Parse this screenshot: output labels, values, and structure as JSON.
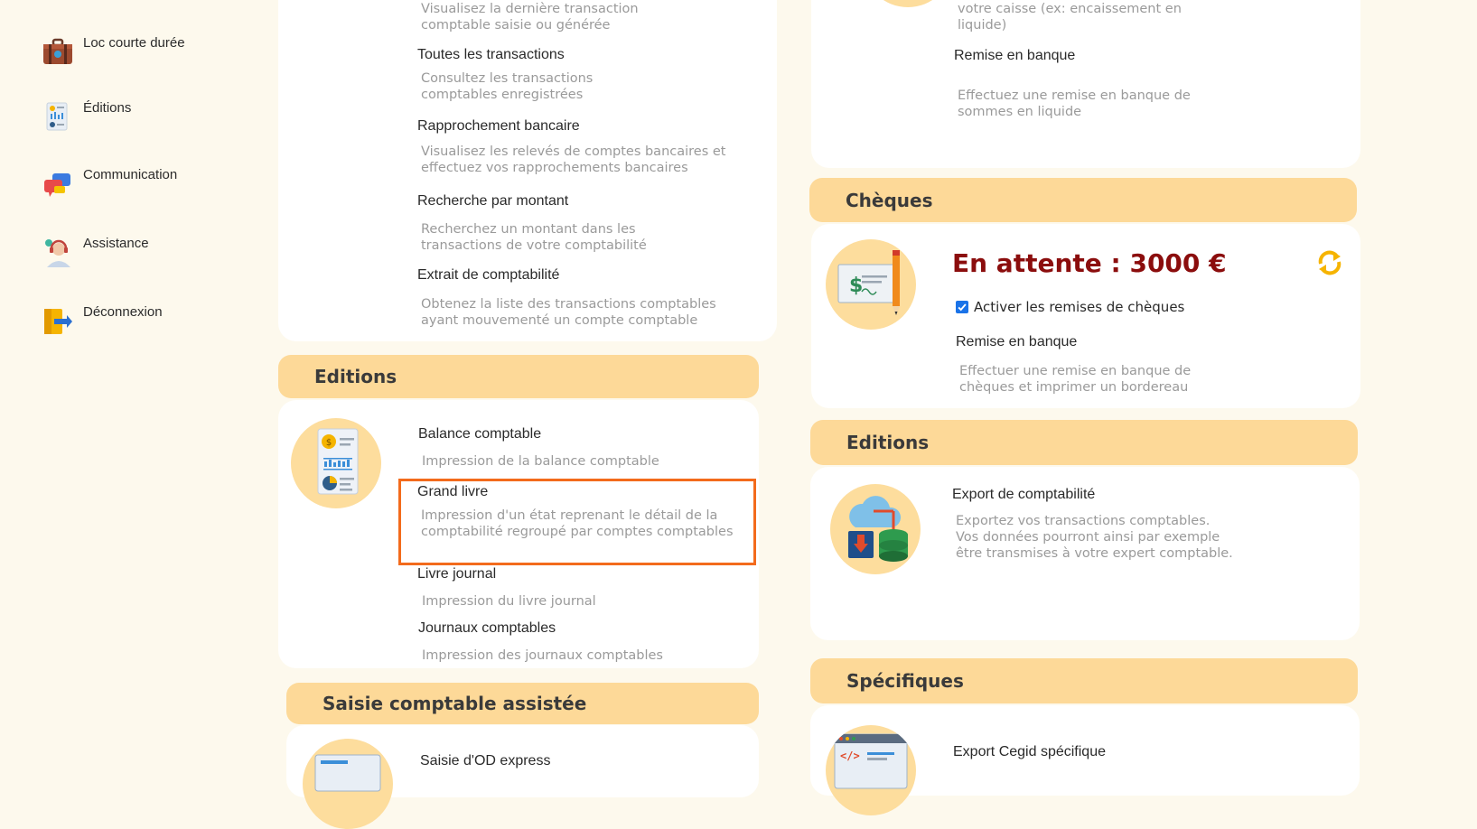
{
  "sidebar": {
    "items": [
      {
        "label": "Loc courte durée",
        "icon": "briefcase-icon"
      },
      {
        "label": "Éditions",
        "icon": "report-icon"
      },
      {
        "label": "Communication",
        "icon": "chat-icon"
      },
      {
        "label": "Assistance",
        "icon": "support-agent-icon"
      },
      {
        "label": "Déconnexion",
        "icon": "logout-icon"
      }
    ]
  },
  "left_top": {
    "frag_desc": "Visualisez la dernière transaction comptable saisie ou générée",
    "items": [
      {
        "title": "Toutes les transactions",
        "desc": "Consultez les transactions comptables enregistrées"
      },
      {
        "title": "Rapprochement bancaire",
        "desc": "Visualisez les relevés de comptes bancaires et effectuez vos rapprochements bancaires"
      },
      {
        "title": "Recherche par montant",
        "desc": "Recherchez un montant dans les transactions de votre comptabilité"
      },
      {
        "title": "Extrait de comptabilité",
        "desc": "Obtenez la liste des transactions comptables ayant mouvementé un compte comptable"
      }
    ]
  },
  "editions_left": {
    "header": "Editions",
    "items": [
      {
        "title": "Balance comptable",
        "desc": "Impression de la balance comptable"
      },
      {
        "title": "Grand livre",
        "desc": "Impression d'un état reprenant le détail de la comptabilité regroupé par comptes comptables"
      },
      {
        "title": "Livre journal",
        "desc": "Impression du livre journal"
      },
      {
        "title": "Journaux comptables",
        "desc": "Impression des journaux comptables"
      }
    ]
  },
  "saisie": {
    "header": "Saisie comptable assistée",
    "item_title": "Saisie d'OD express"
  },
  "caisse": {
    "frag_desc": "votre caisse (ex: encaissement en liquide)",
    "item_title": "Remise en banque",
    "item_desc": "Effectuez une remise en banque de sommes en liquide"
  },
  "cheques": {
    "header": "Chèques",
    "pending": "En attente : 3000 €",
    "checkbox_label": "Activer les remises de chèques",
    "checkbox_checked": true,
    "item_title": "Remise en banque",
    "item_desc": "Effectuer une remise en banque de chèques et imprimer un bordereau"
  },
  "editions_right": {
    "header": "Editions",
    "item_title": "Export de comptabilité",
    "item_desc": "Exportez vos transactions comptables. Vos données pourront ainsi par exemple être transmises à votre expert comptable."
  },
  "specifiques": {
    "header": "Spécifiques",
    "item_title": "Export Cegid spécifique"
  },
  "colors": {
    "accent": "#fdd998",
    "highlight": "#f36b1c",
    "pending": "#8b0d0d",
    "refresh": "#f6b400"
  }
}
